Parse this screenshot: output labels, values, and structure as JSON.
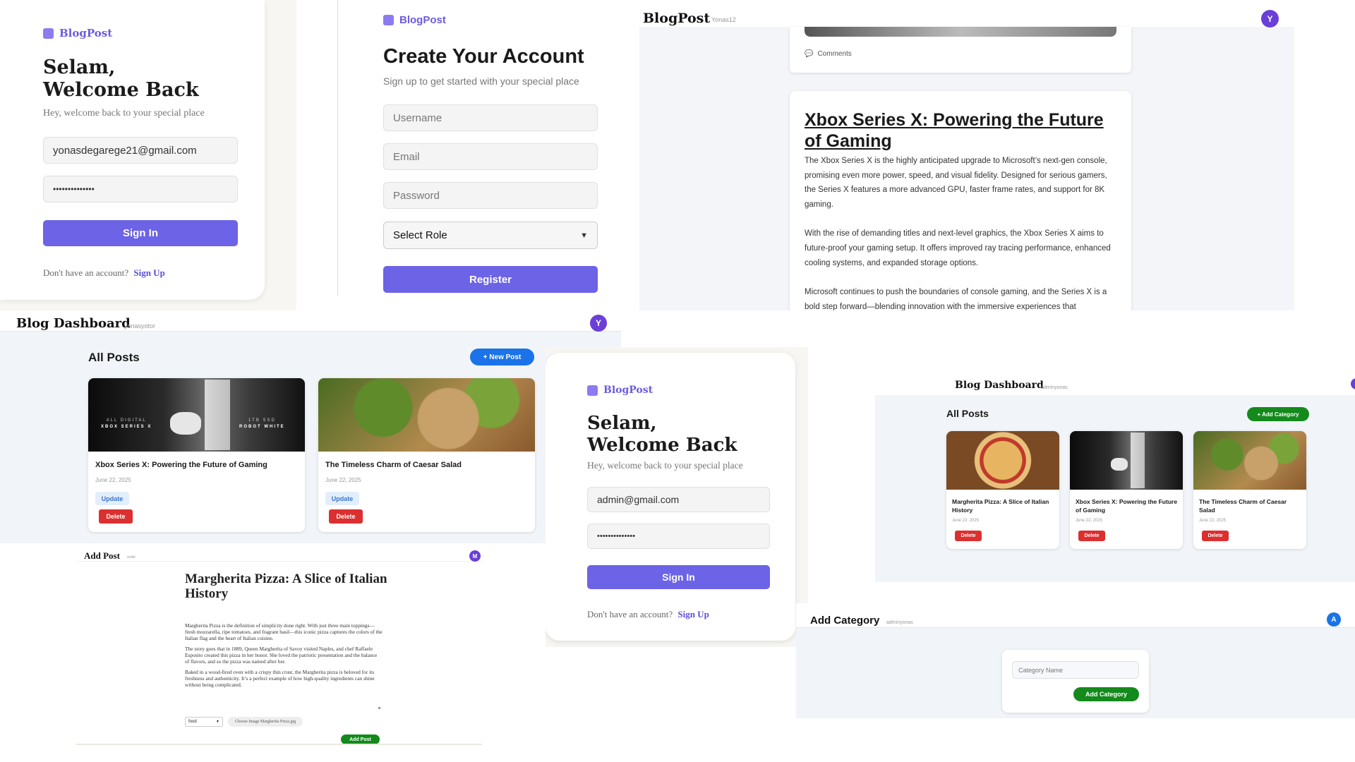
{
  "login1": {
    "brand": "BlogPost",
    "title_line1": "Selam,",
    "title_line2": "Welcome Back",
    "subtitle": "Hey, welcome back to your special place",
    "email": "yonasdegarege21@gmail.com",
    "password": "••••••••••••••",
    "signin": "Sign In",
    "no_account": "Don't have an account?",
    "signup": "Sign Up"
  },
  "register": {
    "brand": "BlogPost",
    "title": "Create Your Account",
    "subtitle": "Sign up to get started with your special place",
    "username_ph": "Username",
    "email_ph": "Email",
    "password_ph": "Password",
    "role_select": "Select Role",
    "register": "Register"
  },
  "post_view": {
    "brand": "BlogPost",
    "user": "Yonas12",
    "avatar": "Y",
    "comments": "Comments",
    "title": "Xbox Series X: Powering the Future of Gaming",
    "p1": "The Xbox Series X is the highly anticipated upgrade to Microsoft’s next-gen console, promising even more power, speed, and visual fidelity. Designed for serious gamers, the Series X features a more advanced GPU, faster frame rates, and support for 8K gaming.",
    "p2": "With the rise of demanding titles and next-level graphics, the Xbox Series X aims to future-proof your gaming setup. It offers improved ray tracing performance, enhanced cooling systems, and expanded storage options.",
    "p3": "Microsoft continues to push the boundaries of console gaming, and the Series X is a bold step forward—blending innovation with the immersive experiences that"
  },
  "dash1": {
    "title": "Blog Dashboard",
    "user": "yonasyotor",
    "avatar": "Y",
    "heading": "All Posts",
    "new_post": "+ New Post",
    "posts": [
      {
        "title": "Xbox Series X: Powering the Future of Gaming",
        "date": "June 22, 2025",
        "update": "Update",
        "delete": "Delete",
        "img_left": "ALL DIGITAL",
        "img_left2": "XBOX SERIES X",
        "img_right": "1TB SSD",
        "img_right2": "ROBOT WHITE"
      },
      {
        "title": "The Timeless Charm of Caesar Salad",
        "date": "June 22, 2025",
        "update": "Update",
        "delete": "Delete"
      }
    ]
  },
  "add_post": {
    "title": "Add Post",
    "user": "mulle",
    "avatar": "M",
    "post_title": "Margherita Pizza: A Slice of Italian History",
    "p1": "Margherita Pizza is the definition of simplicity done right. With just three main toppings—fresh mozzarella, ripe tomatoes, and fragrant basil—this iconic pizza captures the colors of the Italian flag and the heart of Italian cuisine.",
    "p2": "The story goes that in 1889, Queen Margherita of Savoy visited Naples, and chef Raffaele Esposito created this pizza in her honor. She loved the patriotic presentation and the balance of flavors, and so the pizza was named after her.",
    "p3": "Baked in a wood-fired oven with a crispy thin crust, the Margherita pizza is beloved for its freshness and authenticity. It’s a perfect example of how high-quality ingredients can shine without being complicated.",
    "category": "food",
    "file": "Choose Image Margherita Pizza.jpg",
    "submit": "Add Post"
  },
  "login2": {
    "brand": "BlogPost",
    "title_line1": "Selam,",
    "title_line2": "Welcome Back",
    "subtitle": "Hey, welcome back to your special place",
    "email": "admin@gmail.com",
    "password": "••••••••••••••",
    "signin": "Sign In",
    "no_account": "Don't have an account?",
    "signup": "Sign Up"
  },
  "dash2": {
    "title": "Blog Dashboard",
    "user": "adminyonas",
    "heading": "All Posts",
    "add_category": "+ Add Category",
    "posts": [
      {
        "title": "Margherita Pizza: A Slice of Italian History",
        "date": "June 22, 2025",
        "delete": "Delete"
      },
      {
        "title": "Xbox Series X: Powering the Future of Gaming",
        "date": "June 22, 2025",
        "delete": "Delete"
      },
      {
        "title": "The Timeless Charm of Caesar Salad",
        "date": "June 22, 2025",
        "delete": "Delete"
      }
    ]
  },
  "add_category": {
    "title": "Add Category",
    "user": "adminyonas",
    "avatar": "A",
    "input_ph": "Category Name",
    "submit": "Add Category"
  }
}
